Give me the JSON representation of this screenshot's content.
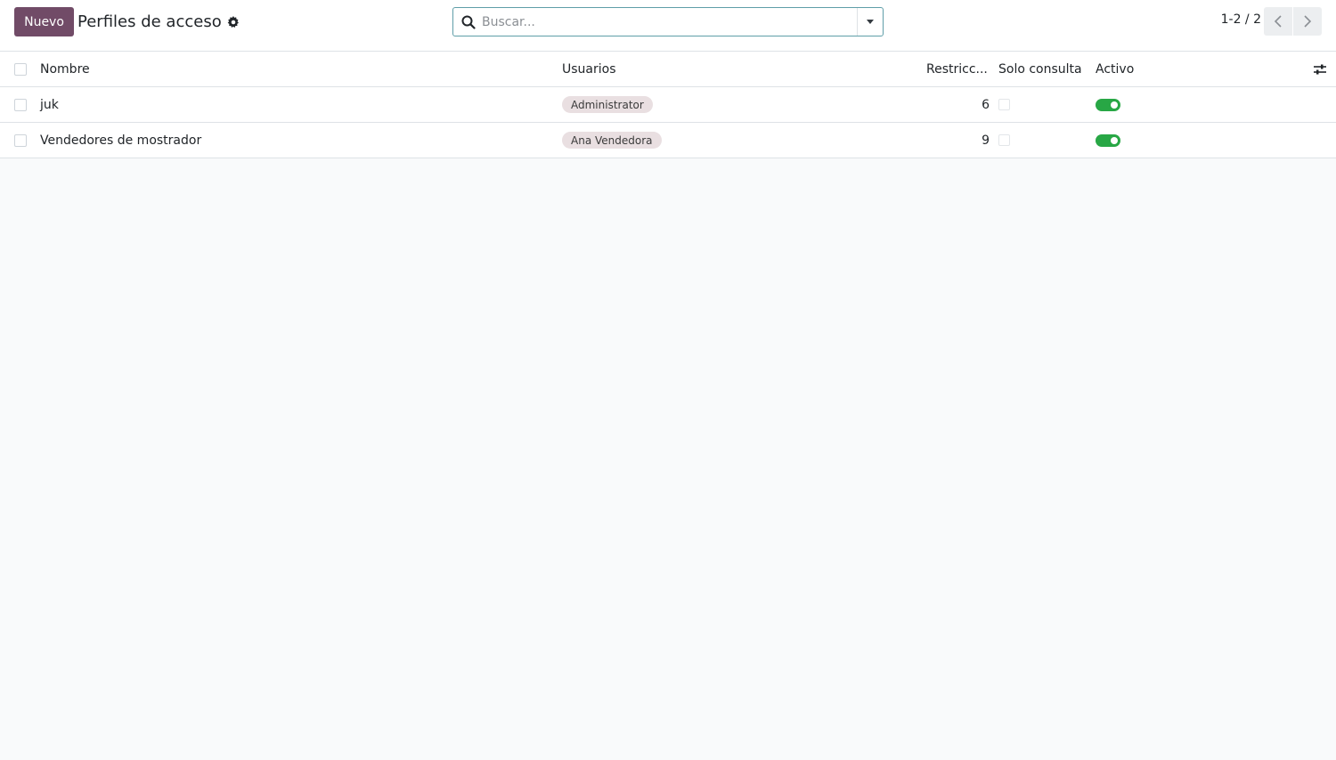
{
  "control_panel": {
    "new_button": "Nuevo",
    "title": "Perfiles de acceso",
    "search_placeholder": "Buscar...",
    "pager_value": "1-2 / 2"
  },
  "list": {
    "columns": {
      "name": "Nombre",
      "users": "Usuarios",
      "restrictions": "Restricc...",
      "readonly": "Solo consulta",
      "active": "Activo"
    },
    "rows": [
      {
        "name": "juk",
        "user_tag": "Administrator",
        "restrictions": "6",
        "readonly": false,
        "active": true
      },
      {
        "name": "Vendedores de mostrador",
        "user_tag": "Ana Vendedora",
        "restrictions": "9",
        "readonly": false,
        "active": true
      }
    ]
  },
  "colors": {
    "primary": "#714b67",
    "toggle_on": "#28a745",
    "tag_bg": "#e9dfe1"
  },
  "icons": [
    "gear-icon",
    "search-icon",
    "caret-down-icon",
    "chevron-left-icon",
    "chevron-right-icon",
    "column-settings-icon"
  ]
}
